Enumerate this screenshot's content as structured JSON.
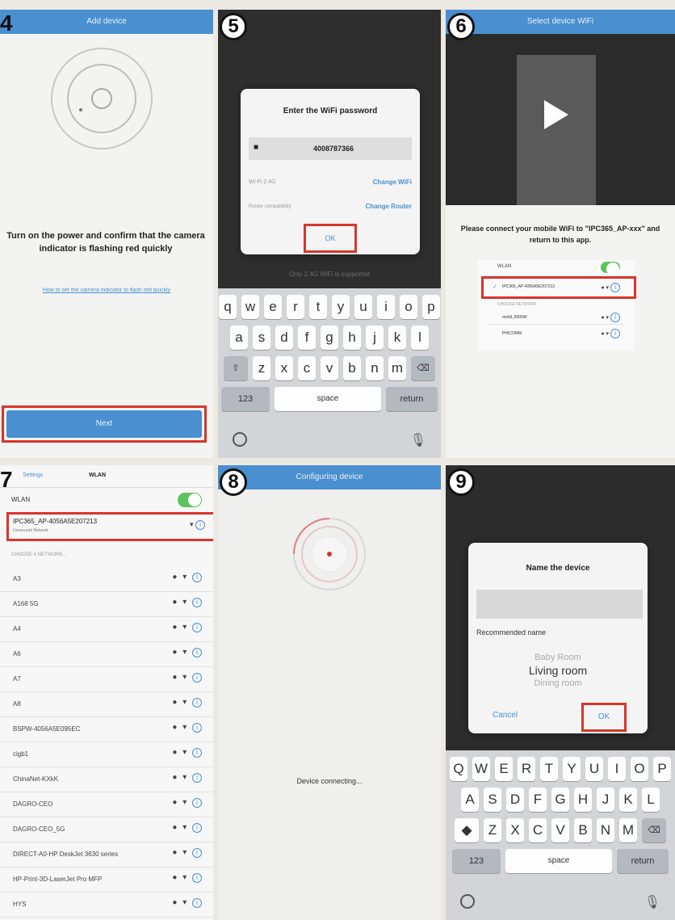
{
  "step4": {
    "number": "4",
    "title": "Add device",
    "instruction": "Turn on the power and confirm that the camera indicator is flashing red quickly",
    "link": "How to set the camera indicator to flash red quickly",
    "button": "Next"
  },
  "step5": {
    "number": "5",
    "dialog_title": "Enter the WiFi password",
    "password": "4008787366",
    "network_label": "Wi-Fi 2.4G",
    "change_wifi": "Change WiFi",
    "router_label": "Router compatibility",
    "change_router": "Change Router",
    "ok": "OK",
    "note": "Only 2.4G WiFi is supported",
    "keyboard": {
      "row1": [
        "q",
        "w",
        "e",
        "r",
        "t",
        "y",
        "u",
        "i",
        "o",
        "p"
      ],
      "row2": [
        "a",
        "s",
        "d",
        "f",
        "g",
        "h",
        "j",
        "k",
        "l"
      ],
      "row3": [
        "z",
        "x",
        "c",
        "v",
        "b",
        "n",
        "m"
      ],
      "num_key": "123",
      "space": "space",
      "return": "return"
    }
  },
  "step6": {
    "number": "6",
    "title": "Select device WiFi",
    "instruction": "Please connect your mobile WiFi to \"IPC365_AP-xxx\" and return to this app.",
    "wlan": "WLAN",
    "selected_network": "IPC365_AP-4056A5E207213",
    "section": "CHOOSE NETWORK",
    "networks": [
      "mobil_6505W",
      "PHICOMM"
    ]
  },
  "step7": {
    "number": "7",
    "back": "Settings",
    "title": "WLAN",
    "wlan_label": "WLAN",
    "connected_name": "IPC365_AP-4056A5E207213",
    "connected_status": "Unsecured Network",
    "section": "CHOOSE A NETWORK...",
    "networks": [
      "A3",
      "A168 5G",
      "A4",
      "A6",
      "A7",
      "A8",
      "BSPW-4056A5E095EC",
      "cigb1",
      "ChinaNet-KXkK",
      "DAGRO-CEO",
      "DAGRO-CEO_5G",
      "DIRECT-A0-HP DeskJet 3630 series",
      "HP-Print-3D-LaserJet Pro MFP",
      "HYS"
    ]
  },
  "step8": {
    "number": "8",
    "title": "Configuring device",
    "status": "Device connecting..."
  },
  "step9": {
    "number": "9",
    "dialog_title": "Name the device",
    "recommended": "Recommended name",
    "names": [
      "Baby Room",
      "Living room",
      "Dining room"
    ],
    "cancel": "Cancel",
    "ok": "OK",
    "keyboard": {
      "row1": [
        "Q",
        "W",
        "E",
        "R",
        "T",
        "Y",
        "U",
        "I",
        "O",
        "P"
      ],
      "row2": [
        "A",
        "S",
        "D",
        "F",
        "G",
        "H",
        "J",
        "K",
        "L"
      ],
      "row3": [
        "Z",
        "X",
        "C",
        "V",
        "B",
        "N",
        "M"
      ],
      "num_key": "123",
      "space": "space",
      "return": "return"
    }
  },
  "colors": {
    "accent": "#4a8fcf",
    "highlight": "#d8352a",
    "toggle": "#5cc45c"
  }
}
